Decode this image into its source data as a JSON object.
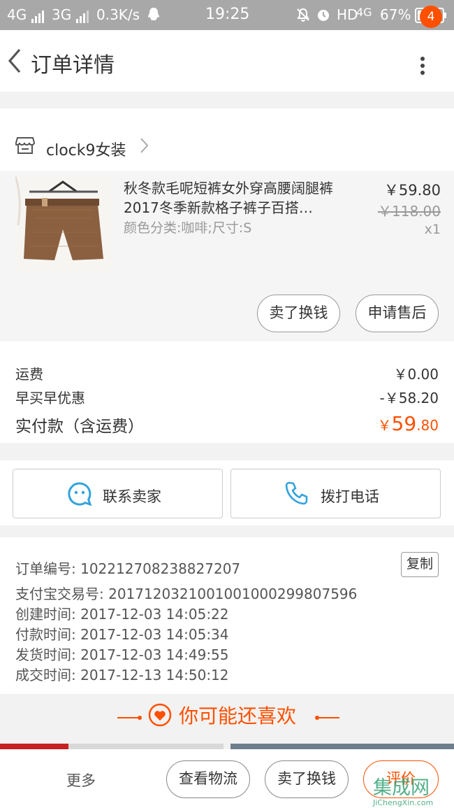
{
  "status_bar": {
    "network1": "4G",
    "network2": "3G",
    "speed": "0.3K/s",
    "time": "19:25",
    "hd": "HD",
    "network3": "4G",
    "battery": "67%"
  },
  "header": {
    "title": "订单详情",
    "badge_count": "4"
  },
  "shop": {
    "name": "clock9女装"
  },
  "product": {
    "title": "秋冬款毛呢短裤女外穿高腰阔腿裤2017冬季新款格子裤子百搭…",
    "sku": "颜色分类:咖啡;尺寸:S",
    "price": "￥59.80",
    "original_price": "￥118.00",
    "quantity": "x1",
    "sell_button": "卖了换钱",
    "aftersale_button": "申请售后"
  },
  "totals": {
    "shipping_label": "运费",
    "shipping_value": "￥0.00",
    "discount_label": "早买早优惠",
    "discount_value": "-￥58.20",
    "paid_label": "实付款（含运费）",
    "paid_currency": "￥",
    "paid_integer": "59",
    "paid_decimal": ".80"
  },
  "contact": {
    "seller_label": "联系卖家",
    "phone_label": "拨打电话"
  },
  "order_info": {
    "lines": [
      "订单编号: 102212708238827207",
      "支付宝交易号: 2017120321001001000299807596",
      "创建时间: 2017-12-03 14:05:22",
      "付款时间: 2017-12-03 14:05:34",
      "发货时间: 2017-12-03 14:49:55",
      "成交时间: 2017-12-13 14:50:12"
    ],
    "copy_label": "复制"
  },
  "recommend": {
    "title": "你可能还喜欢"
  },
  "bottom_bar": {
    "more_label": "更多",
    "logistics_button": "查看物流",
    "sell_button": "卖了换钱",
    "review_button": "评价"
  },
  "watermark": {
    "text": "集成网",
    "sub": "JiChengXin.com"
  },
  "colors": {
    "accent": "#ff5000",
    "icon_blue": "#33a3dc"
  }
}
